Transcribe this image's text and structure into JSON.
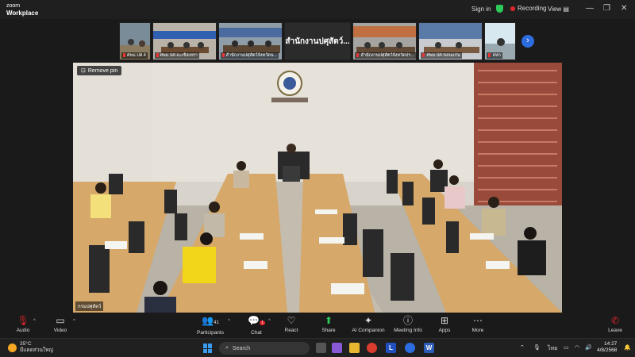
{
  "app": {
    "brand_line1": "zoom",
    "brand_line2": "Workplace"
  },
  "header": {
    "signin": "Sign in",
    "recording": "Recording",
    "view": "View"
  },
  "thumbnails": [
    {
      "label": "ศพม.ปศ.4"
    },
    {
      "label": "ศพม.ปศ.ฉะเชิงเทรา"
    },
    {
      "label": "สำนักงานปศุสัตว์จังหวัดน..."
    },
    {
      "label": "สำนักงานปศุสัตว์..."
    },
    {
      "label": "สำนักงานปศุสัตว์จังหวัดปร..."
    },
    {
      "label": "ศพม.ปศ.ขอนแก่น"
    },
    {
      "label": "สหก"
    }
  ],
  "main_video": {
    "remove_pin": "Remove pin",
    "label": "กรมปศุสัตว์"
  },
  "toolbar": {
    "audio": "Audio",
    "video": "Video",
    "participants": "Participants",
    "participants_count": "41",
    "chat": "Chat",
    "chat_badge": "1",
    "react": "React",
    "share": "Share",
    "ai": "AI Companion",
    "meeting_info": "Meeting Info",
    "apps": "Apps",
    "more": "More",
    "leave": "Leave"
  },
  "taskbar": {
    "temp": "35°C",
    "weather": "มีแดดส่วนใหญ่",
    "search": "Search",
    "lang": "ไทย",
    "time": "14:27",
    "date": "4/8/2568"
  },
  "colors": {
    "accent": "#2d6cdf",
    "record": "#e0252b",
    "share": "#2ec95b",
    "leave": "#e0252b"
  }
}
